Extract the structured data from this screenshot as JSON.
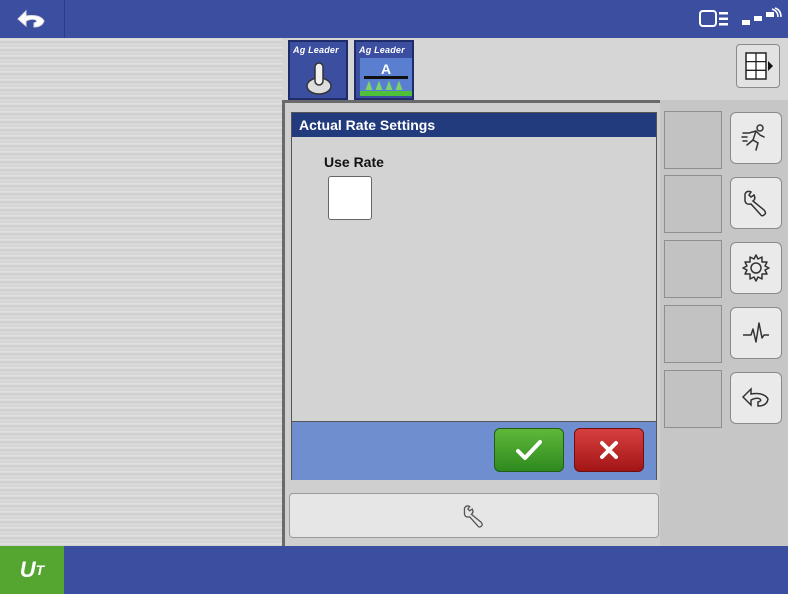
{
  "header": {
    "back_icon": "back-arrow-icon",
    "status_icons": [
      "display-icon",
      "gps-signal-icon"
    ]
  },
  "tabs": [
    {
      "logo": "Ag Leader",
      "icon": "joystick-icon"
    },
    {
      "logo": "Ag Leader",
      "icon": "sprayer-boom-icon"
    }
  ],
  "layout_button_icon": "layout-grid-icon",
  "dialog": {
    "title": "Actual Rate Settings",
    "use_rate_label": "Use Rate",
    "use_rate_checked": false,
    "ok_icon": "checkmark-icon",
    "cancel_icon": "x-icon",
    "colors": {
      "title_bar": "#223b7c",
      "footer": "#6f8ecf",
      "ok": "#3f9b27",
      "cancel": "#c02a2a"
    }
  },
  "side_buttons": [
    "running-person-icon",
    "wrench-icon",
    "gear-icon",
    "diagnostics-pulse-icon",
    "back-arrow-icon"
  ],
  "bottom_button_icon": "wrench-icon",
  "footer": {
    "ut_label": "U",
    "ut_sub": "T",
    "ut_color": "#55a630",
    "bar_color": "#3b4ea0"
  }
}
